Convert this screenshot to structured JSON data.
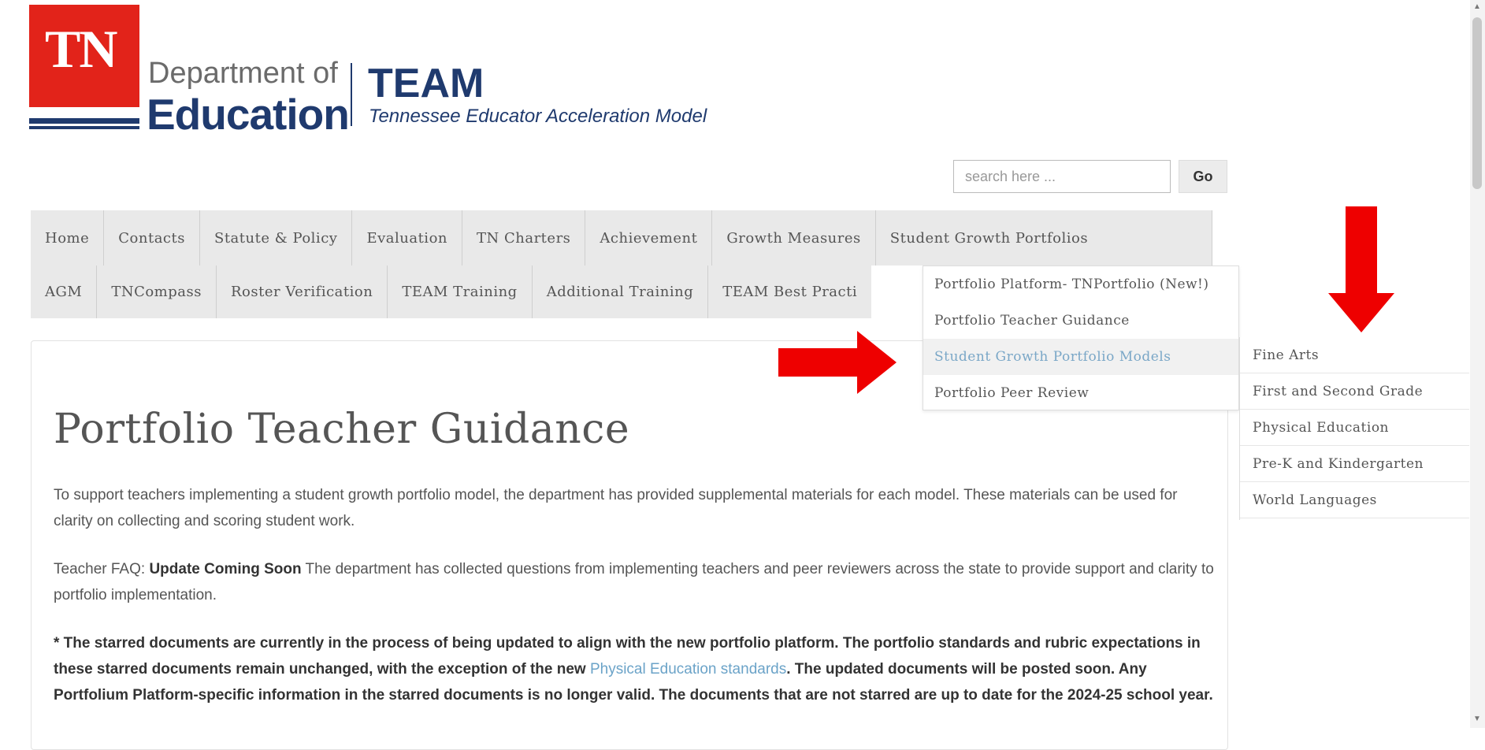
{
  "header": {
    "logo_text": "TN",
    "dept_line1": "Department of",
    "dept_line2": "Education",
    "team_title": "TEAM",
    "team_subtitle": "Tennessee Educator Acceleration Model"
  },
  "search": {
    "placeholder": "search here ...",
    "button_label": "Go"
  },
  "nav": {
    "row1": [
      "Home",
      "Contacts",
      "Statute & Policy",
      "Evaluation",
      "TN Charters",
      "Achievement",
      "Growth Measures",
      "Student Growth Portfolios"
    ],
    "row2": [
      "AGM",
      "TNCompass",
      "Roster Verification",
      "TEAM Training",
      "Additional Training",
      "TEAM Best Practi"
    ]
  },
  "dropdown": {
    "items": [
      "Portfolio Platform- TNPortfolio (New!)",
      "Portfolio Teacher Guidance",
      "Student Growth Portfolio Models",
      "Portfolio Peer Review"
    ],
    "highlighted_index": 2,
    "submenu": [
      "Fine Arts",
      "First and Second Grade",
      "Physical Education",
      "Pre-K and Kindergarten",
      "World Languages"
    ]
  },
  "main": {
    "title": "Portfolio Teacher Guidance",
    "para1": "To support teachers implementing a student growth portfolio model, the department has provided supplemental materials for each model. These materials can be used for clarity on collecting and scoring student work.",
    "para2_prefix": "Teacher FAQ: ",
    "para2_bold": "Update Coming Soon",
    "para2_rest": " The department has collected questions from implementing teachers and peer reviewers across the state to provide support and clarity to portfolio implementation.",
    "para3_a": "* The starred documents are currently in the process of being updated to align with the new portfolio platform. The portfolio standards and rubric expectations in these starred documents remain unchanged, with the exception of the new ",
    "para3_link": "Physical Education standards",
    "para3_b": ". The updated documents will be posted soon. Any Portfolium Platform-specific information in the starred documents is no longer valid. The documents that are not starred are up to date for the 2024-25 school year."
  },
  "colors": {
    "brand_red": "#e2231a",
    "brand_navy": "#1f3a6e",
    "link_blue": "#6ba3c8",
    "arrow_red": "#ee0000"
  }
}
